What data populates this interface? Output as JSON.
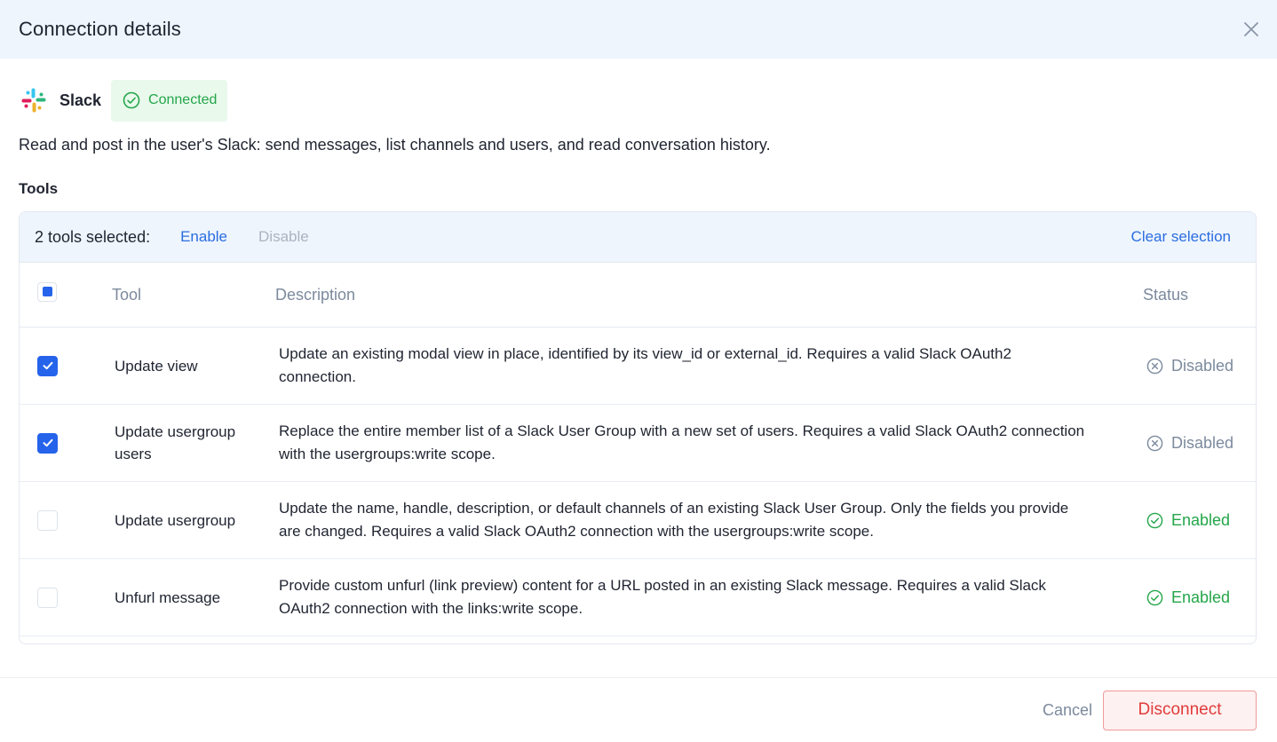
{
  "header": {
    "title": "Connection details"
  },
  "app": {
    "name": "Slack",
    "status": "Connected",
    "description": "Read and post in the user's Slack: send messages, list channels and users, and read conversation history."
  },
  "tools": {
    "section_title": "Tools",
    "selection": {
      "count_label": "2 tools selected:",
      "enable_label": "Enable",
      "disable_label": "Disable",
      "clear_label": "Clear selection"
    },
    "columns": {
      "tool": "Tool",
      "description": "Description",
      "status": "Status"
    },
    "rows": [
      {
        "checked": true,
        "tool": "Update view",
        "description": "Update an existing modal view in place, identified by its view_id or external_id. Requires a valid Slack OAuth2 connection.",
        "status": "Disabled"
      },
      {
        "checked": true,
        "tool": "Update usergroup users",
        "description": "Replace the entire member list of a Slack User Group with a new set of users. Requires a valid Slack OAuth2 connection with the usergroups:write scope.",
        "status": "Disabled"
      },
      {
        "checked": false,
        "tool": "Update usergroup",
        "description": "Update the name, handle, description, or default channels of an existing Slack User Group. Only the fields you provide are changed. Requires a valid Slack OAuth2 connection with the usergroups:write scope.",
        "status": "Enabled"
      },
      {
        "checked": false,
        "tool": "Unfurl message",
        "description": "Provide custom unfurl (link preview) content for a URL posted in an existing Slack message. Requires a valid Slack OAuth2 connection with the links:write scope.",
        "status": "Enabled"
      }
    ]
  },
  "footer": {
    "cancel_label": "Cancel",
    "disconnect_label": "Disconnect"
  },
  "colors": {
    "accent": "#2563eb",
    "success": "#24a64a",
    "danger": "#e23b3b",
    "muted": "#7c8a9d",
    "header_bg": "#eef5fd"
  }
}
